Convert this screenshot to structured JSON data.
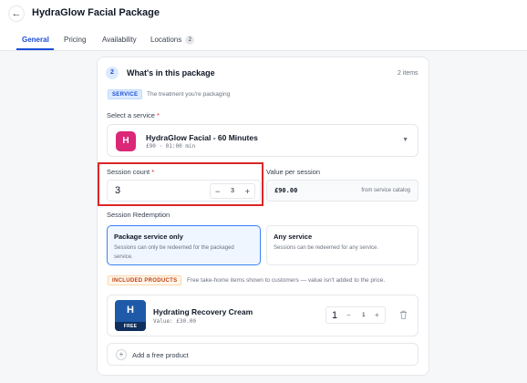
{
  "header": {
    "title": "HydraGlow Facial Package",
    "back_icon": "arrow-left-icon"
  },
  "tabs": [
    {
      "label": "General",
      "active": true
    },
    {
      "label": "Pricing",
      "active": false
    },
    {
      "label": "Availability",
      "active": false
    },
    {
      "label": "Locations",
      "active": false,
      "badge": "2"
    }
  ],
  "section": {
    "step": "2",
    "title": "What's in this package",
    "items_count": "2 items",
    "service_tag": "SERVICE",
    "service_hint": "The treatment you're packaging",
    "select_label": "Select a service",
    "required_mark": "*",
    "selected_service": {
      "initial": "H",
      "name": "HydraGlow Facial - 60 Minutes",
      "meta": "£90 · 01:00 min",
      "avatar_color": "#db2777"
    },
    "session_count_label": "Session count",
    "session_count_value": "3",
    "stepper_value": "3",
    "value_label": "Value per session",
    "value_amount": "£90.00",
    "value_source": "from service catalog",
    "redemption_label": "Session Redemption",
    "redemption_options": [
      {
        "title": "Package service only",
        "desc": "Sessions can only be redeemed for the packaged service.",
        "selected": true
      },
      {
        "title": "Any service",
        "desc": "Sessions can be redeemed for any service.",
        "selected": false
      }
    ],
    "included_tag": "INCLUDED PRODUCTS",
    "included_hint": "Free take-home items shown to customers — value isn't added to the price.",
    "product": {
      "initial": "H",
      "badge": "FREE",
      "name": "Hydrating Recovery Cream",
      "value": "Value: £30.00",
      "qty_display": "1",
      "qty_stepper": "1"
    },
    "add_product_label": "Add a free product"
  },
  "colors": {
    "accent": "#1d4ed8",
    "highlight": "#dc2626",
    "included": "#c2410c"
  }
}
